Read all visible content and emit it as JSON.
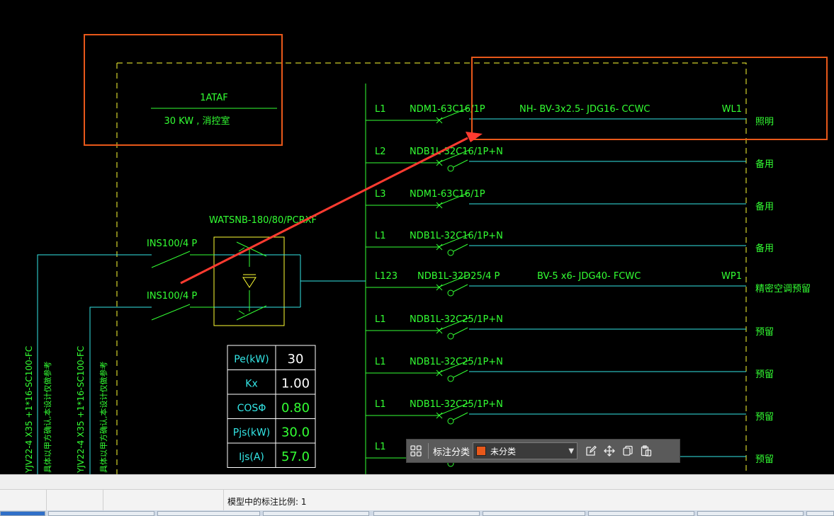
{
  "drawing": {
    "panel_name": "1ATAF",
    "panel_desc": "30 KW , 消控室",
    "ats_model": "WATSNB-180/80/PCRXF",
    "incoming": [
      {
        "switch": "INS100/4 P",
        "cable": "YJV22-4 X35 +1*16-SC100-FC",
        "note": "具体以甲方确认,本设计仅做参考"
      },
      {
        "switch": "INS100/4 P",
        "cable": "YJV22-4 X35 +1*16-SC100-FC",
        "note": "具体以甲方确认,本设计仅做参考"
      }
    ],
    "circuits": [
      {
        "phase": "L1",
        "breaker": "NDM1-63C16/1P",
        "cable": "NH- BV-3x2.5- JDG16- CCWC",
        "id": "WL1",
        "use": "照明"
      },
      {
        "phase": "L2",
        "breaker": "NDB1L-32C16/1P+N",
        "cable": "",
        "id": "",
        "use": "备用"
      },
      {
        "phase": "L3",
        "breaker": "NDM1-63C16/1P",
        "cable": "",
        "id": "",
        "use": "备用"
      },
      {
        "phase": "L1",
        "breaker": "NDB1L-32C16/1P+N",
        "cable": "",
        "id": "",
        "use": "备用"
      },
      {
        "phase": "L123",
        "breaker": "NDB1L-32D25/4 P",
        "cable": "BV-5 x6- JDG40- FCWC",
        "id": "WP1",
        "use": "精密空调预留"
      },
      {
        "phase": "L1",
        "breaker": "NDB1L-32C25/1P+N",
        "cable": "",
        "id": "",
        "use": "预留"
      },
      {
        "phase": "L1",
        "breaker": "NDB1L-32C25/1P+N",
        "cable": "",
        "id": "",
        "use": "预留"
      },
      {
        "phase": "L1",
        "breaker": "NDB1L-32C25/1P+N",
        "cable": "",
        "id": "",
        "use": "预留"
      },
      {
        "phase": "L1",
        "breaker": "",
        "cable": "",
        "id": "",
        "use": "预留"
      }
    ],
    "params": [
      {
        "label": "Pe(kW)",
        "value": "30"
      },
      {
        "label": "Kx",
        "value": "1.00"
      },
      {
        "label": "COSΦ",
        "value": "0.80"
      },
      {
        "label": "Pjs(kW)",
        "value": "30.0"
      },
      {
        "label": "Ijs(A)",
        "value": "57.0"
      }
    ]
  },
  "annotation_toolbar": {
    "category_label": "标注分类",
    "category_value": "未分类",
    "category_color": "#e8581a",
    "icons": [
      "grid-icon",
      "edit-icon",
      "move-icon",
      "copy-icon",
      "paste-icon"
    ]
  },
  "statusbar": {
    "scale_text": "模型中的标注比例: 1"
  },
  "colors": {
    "cad_green": "#33ff33",
    "cad_cyan": "#33e6e6",
    "cad_yellow": "#ffff33",
    "highlight_orange": "#e8581a",
    "arrow_red": "#ff3b30"
  }
}
